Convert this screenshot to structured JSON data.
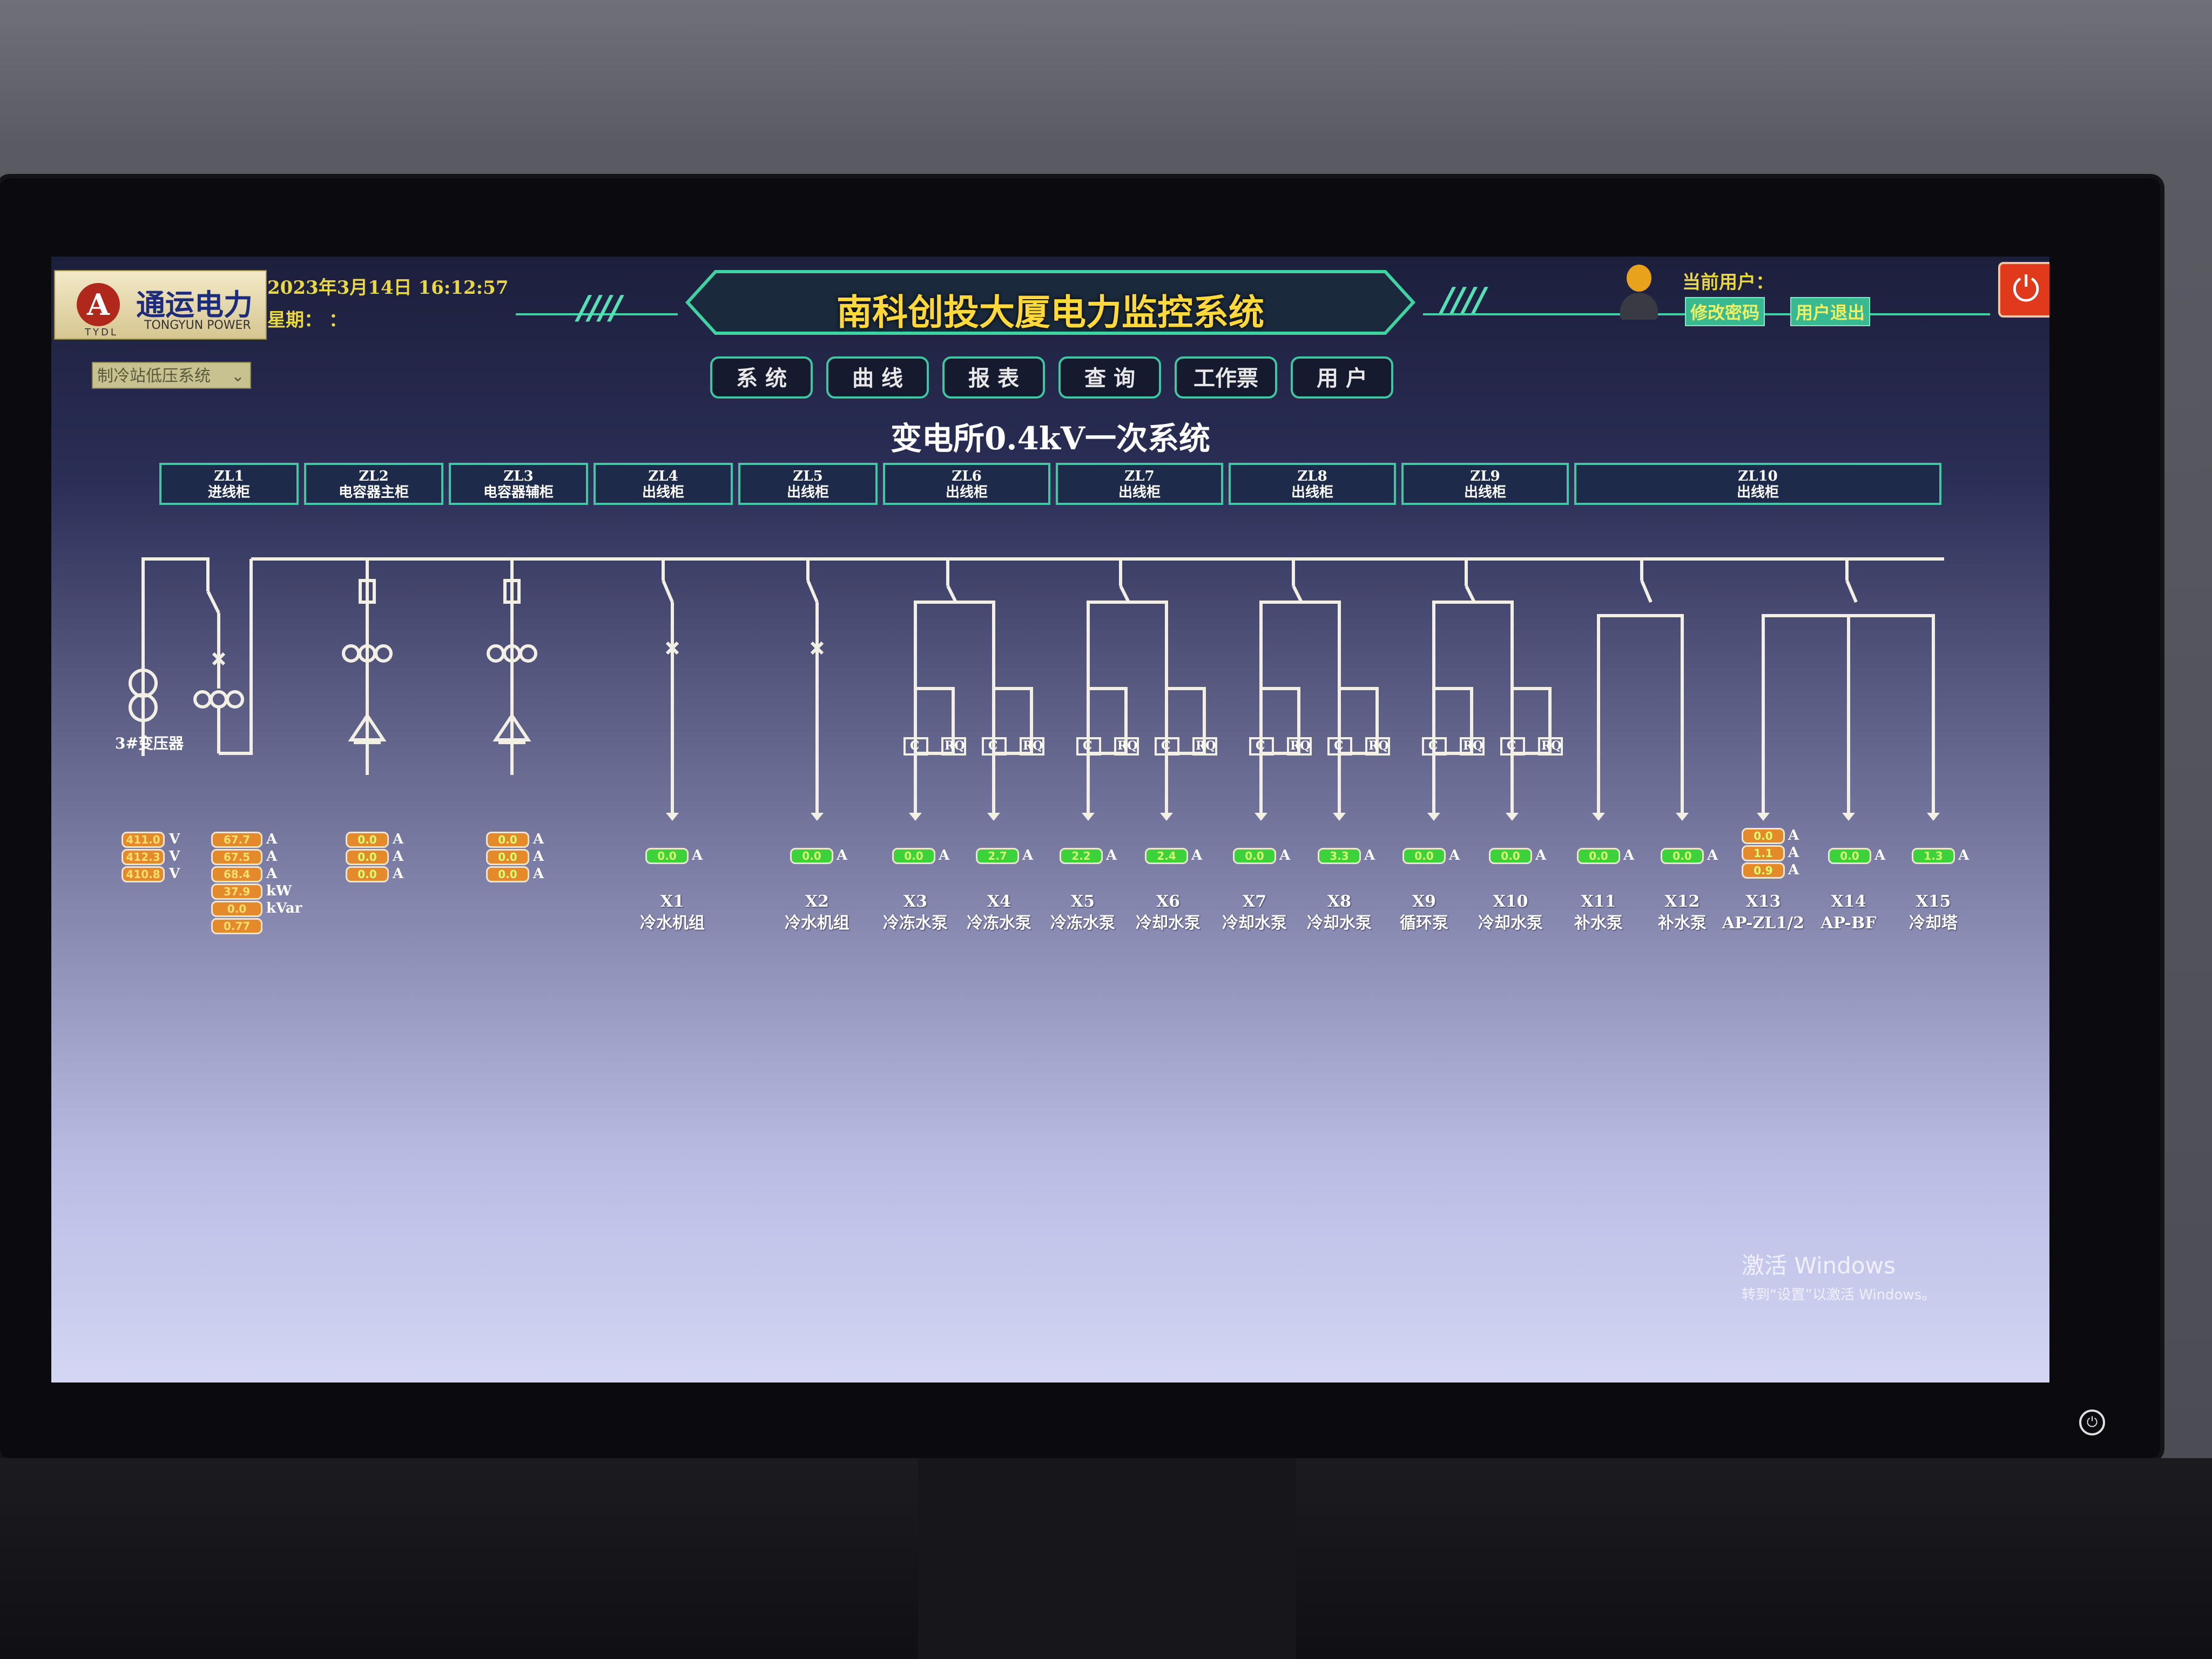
{
  "header": {
    "logo_cn": "通运电力",
    "logo_en": "TONGYUN POWER",
    "logo_abbr": "TYDL",
    "datetime": "2023年3月14日 16:12:57",
    "weekday": "星期： ：",
    "system_title": "南科创投大厦电力监控系统",
    "current_user_label": "当前用户：",
    "change_password": "修改密码",
    "logout": "用户退出"
  },
  "system_select": {
    "value": "制冷站低压系统"
  },
  "nav": [
    {
      "label": "系 统"
    },
    {
      "label": "曲 线"
    },
    {
      "label": "报 表"
    },
    {
      "label": "查 询"
    },
    {
      "label": "工作票"
    },
    {
      "label": "用 户"
    }
  ],
  "page_title": "变电所0.4kV一次系统",
  "cabinets": [
    {
      "id": "ZL1",
      "type": "进线柜"
    },
    {
      "id": "ZL2",
      "type": "电容器主柜"
    },
    {
      "id": "ZL3",
      "type": "电容器辅柜"
    },
    {
      "id": "ZL4",
      "type": "出线柜"
    },
    {
      "id": "ZL5",
      "type": "出线柜"
    },
    {
      "id": "ZL6",
      "type": "出线柜"
    },
    {
      "id": "ZL7",
      "type": "出线柜"
    },
    {
      "id": "ZL8",
      "type": "出线柜"
    },
    {
      "id": "ZL9",
      "type": "出线柜"
    },
    {
      "id": "ZL10",
      "type": "出线柜"
    }
  ],
  "transformer_label": "3#变压器",
  "incoming": {
    "voltages": [
      "411.0",
      "412.3",
      "410.8"
    ],
    "voltage_unit": "V",
    "currents": [
      "67.7",
      "67.5",
      "68.4"
    ],
    "current_unit": "A",
    "power_kw": "37.9",
    "power_kvar": "0.0",
    "power_factor": "0.77",
    "kw_unit": "kW",
    "kvar_unit": "kVar"
  },
  "capacitor_meters": [
    {
      "values": [
        "0.0",
        "0.0",
        "0.0"
      ],
      "unit": "A"
    },
    {
      "values": [
        "0.0",
        "0.0",
        "0.0"
      ],
      "unit": "A"
    }
  ],
  "feeders": [
    {
      "id": "X1",
      "name": "冷水机组",
      "current": "0.0",
      "unit": "A"
    },
    {
      "id": "X2",
      "name": "冷水机组",
      "current": "0.0",
      "unit": "A"
    },
    {
      "id": "X3",
      "name": "冷冻水泵",
      "current": "0.0",
      "unit": "A"
    },
    {
      "id": "X4",
      "name": "冷冻水泵",
      "current": "2.7",
      "unit": "A"
    },
    {
      "id": "X5",
      "name": "冷冻水泵",
      "current": "2.2",
      "unit": "A"
    },
    {
      "id": "X6",
      "name": "冷却水泵",
      "current": "2.4",
      "unit": "A"
    },
    {
      "id": "X7",
      "name": "冷却水泵",
      "current": "0.0",
      "unit": "A"
    },
    {
      "id": "X8",
      "name": "冷却水泵",
      "current": "3.3",
      "unit": "A"
    },
    {
      "id": "X9",
      "name": "循环泵",
      "current": "0.0",
      "unit": "A"
    },
    {
      "id": "X10",
      "name": "冷却水泵",
      "current": "0.0",
      "unit": "A"
    },
    {
      "id": "X11",
      "name": "补水泵",
      "current": "0.0",
      "unit": "A"
    },
    {
      "id": "X12",
      "name": "补水泵",
      "current": "0.0",
      "unit": "A"
    },
    {
      "id": "X13",
      "name": "AP-ZL1/2",
      "current": "0.0",
      "unit": "A",
      "stack": [
        "0.0",
        "1.1",
        "0.9"
      ]
    },
    {
      "id": "X14",
      "name": "AP-BF",
      "current": "0.0",
      "unit": "A"
    },
    {
      "id": "X15",
      "name": "冷却塔",
      "current": "1.3",
      "unit": "A"
    }
  ],
  "branch_labels": {
    "left": "C",
    "right": "RQ"
  },
  "watermark": {
    "line1": "激活 Windows",
    "line2": "转到“设置”以激活 Windows。"
  },
  "colors": {
    "accent": "#3fd3a2",
    "title_yellow": "#ffd83a",
    "meter_green": "#3bd23b",
    "meter_orange": "#e48a2a"
  }
}
